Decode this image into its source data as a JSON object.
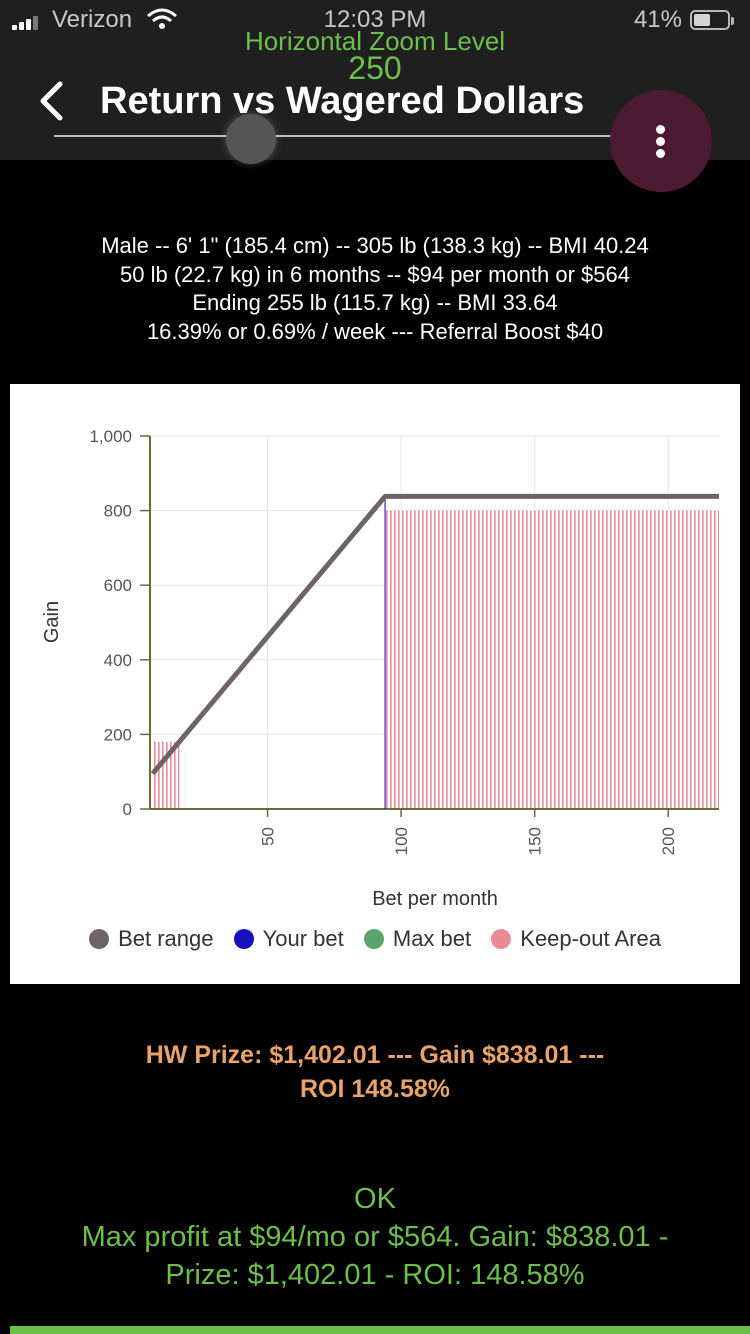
{
  "status_bar": {
    "carrier": "Verizon",
    "time": "12:03 PM",
    "battery": "41%"
  },
  "header": {
    "zoom_label": "Horizontal Zoom Level",
    "zoom_value": "250",
    "title": "Return vs Wagered Dollars",
    "zoom_slider_level": 0.25,
    "icons": {
      "back": "chevron-left-icon",
      "menu": "vertical-dots-icon"
    }
  },
  "info_lines": [
    "Male -- 6' 1\" (185.4 cm) -- 305 lb (138.3 kg) -- BMI 40.24",
    "50 lb (22.7 kg) in 6 months -- $94 per month or $564",
    "Ending 255 lb (115.7 kg) -- BMI 33.64",
    "16.39% or 0.69% / week --- Referral Boost $40"
  ],
  "chart_data": {
    "type": "line",
    "xlabel": "Bet per month",
    "ylabel": "Gain",
    "xlim": [
      6,
      219
    ],
    "ylim": [
      0,
      1000
    ],
    "x_ticks": [
      "50",
      "100",
      "150",
      "200"
    ],
    "x_tick_values": [
      50,
      100,
      150,
      200
    ],
    "y_ticks": [
      "0",
      "200",
      "400",
      "600",
      "800",
      "1,000"
    ],
    "y_tick_values": [
      0,
      200,
      400,
      600,
      800,
      1000
    ],
    "grid": true,
    "legend_position": "bottom",
    "series": [
      {
        "name": "Bet range",
        "color": "#6e6466",
        "x": [
          7,
          94,
          219
        ],
        "y": [
          95,
          838.01,
          838.01
        ]
      },
      {
        "name": "Your bet",
        "color": "#1a0fbd",
        "x": [
          94,
          94
        ],
        "y": [
          0,
          838.01
        ]
      },
      {
        "name": "Max bet",
        "color": "#5aa469"
      },
      {
        "name": "Keep-out Area",
        "color": "#e88a94",
        "ranges": [
          [
            7,
            17
          ],
          [
            94,
            219
          ]
        ],
        "tops": [
          180,
          800
        ]
      }
    ]
  },
  "result_lines": [
    "HW Prize: $1,402.01 --- Gain $838.01 ---",
    "ROI 148.58%"
  ],
  "ok_lines": [
    "OK",
    "Max profit at $94/mo or $564. Gain: $838.01 -",
    "Prize: $1,402.01 - ROI: 148.58%"
  ],
  "colors": {
    "accent_green": "#6cbf4a",
    "result_orange": "#e8a26a",
    "menu_purple": "#4b1a33"
  }
}
